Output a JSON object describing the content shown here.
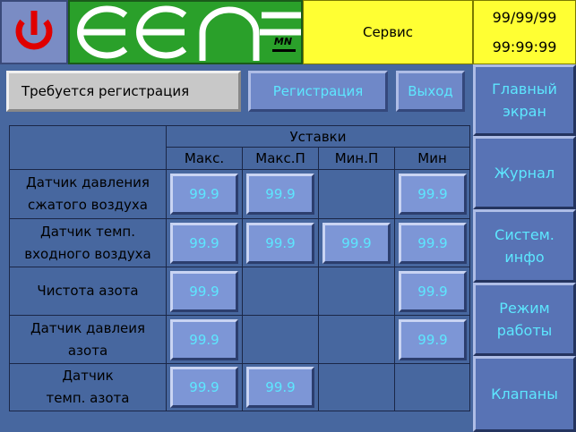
{
  "header": {
    "title": "Сервис",
    "date": "99/99/99",
    "time": "99:99:99",
    "logo_sub": "MN",
    "colors": {
      "power_icon": "#e00000",
      "logo_bg": "#2aa02a",
      "title_bg": "#ffff33"
    }
  },
  "top_bar": {
    "status": "Требуется регистрация",
    "register_label": "Регистрация",
    "exit_label": "Выход"
  },
  "nav": [
    {
      "id": "main",
      "label": "Главный\nэкран"
    },
    {
      "id": "journal",
      "label": "Журнал"
    },
    {
      "id": "sysinfo",
      "label": "Систем.\nинфо"
    },
    {
      "id": "mode",
      "label": "Режим\nработы"
    },
    {
      "id": "valves",
      "label": "Клапаны"
    }
  ],
  "table": {
    "group_header": "Уставки",
    "columns": [
      "Макс.",
      "Макс.П",
      "Мин.П",
      "Мин"
    ],
    "rows": [
      {
        "label": "Датчик давления\nсжатого воздуха",
        "values": [
          "99.9",
          "99.9",
          null,
          "99.9"
        ]
      },
      {
        "label": "Датчик темп.\nвходного воздуха",
        "values": [
          "99.9",
          "99.9",
          "99.9",
          "99.9"
        ]
      },
      {
        "label": "Чистота азота",
        "values": [
          "99.9",
          null,
          null,
          "99.9"
        ]
      },
      {
        "label": "Датчик давлеия\nазота",
        "values": [
          "99.9",
          null,
          null,
          "99.9"
        ]
      },
      {
        "label": "Датчик\nтемп. азота",
        "values": [
          "99.9",
          "99.9",
          null,
          null
        ]
      }
    ]
  },
  "colors": {
    "accent_text": "#5de7ff",
    "panel_bg": "#47679f"
  }
}
